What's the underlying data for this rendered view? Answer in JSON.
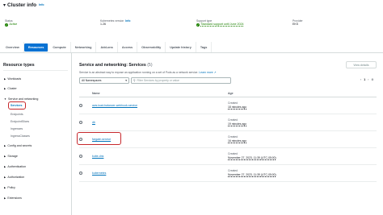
{
  "header": {
    "title": "Cluster info",
    "info_label": "Info"
  },
  "summary": {
    "status_label": "Status",
    "status_value": "Active",
    "k8s_label": "Kubernetes version",
    "k8s_info": "Info",
    "k8s_value": "1.26",
    "support_label": "Support type",
    "support_value": "Standard support until June 2024",
    "provider_label": "Provider",
    "provider_value": "EKS"
  },
  "tabs": [
    "Overview",
    "Resources",
    "Compute",
    "Networking",
    "Add-ons",
    "Access",
    "Observability",
    "Update history",
    "Tags"
  ],
  "sidebar": {
    "title": "Resource types",
    "groups": {
      "workloads": "Workloads",
      "cluster": "Cluster",
      "service_networking": "Service and networking",
      "config": "Config and secrets",
      "storage": "Storage",
      "authentication": "Authentication",
      "authorization": "Authorization",
      "policy": "Policy",
      "extensions": "Extensions"
    },
    "sub_items": [
      "Services",
      "Endpoints",
      "EndpointSlices",
      "Ingresses",
      "IngressClasses"
    ]
  },
  "main": {
    "title": "Service and networking: Services",
    "count": "(5)",
    "view_details": "View details",
    "description": "Service is an abstract way to expose an application running on a set of Pods as a network service.",
    "learn_more": "Learn more",
    "namespace_select": "All Namespaces",
    "search_placeholder": "Filter Services by property or value",
    "page_number": "1",
    "columns": {
      "name": "Name",
      "age": "Age"
    },
    "rows": [
      {
        "name": "aws-load-balancer-webhook-service",
        "age_label": "Created",
        "age": "18 minutes ago"
      },
      {
        "name": "db",
        "age_label": "Created",
        "age": "19 minutes ago"
      },
      {
        "name": "fargate-service",
        "age_label": "Created",
        "age": "16 minutes ago"
      },
      {
        "name": "kube-dns",
        "age_label": "Created",
        "age": "November 27, 2023, 11:39 (UTC-05:00)"
      },
      {
        "name": "kubernetes",
        "age_label": "Created",
        "age": "November 27, 2023, 11:39 (UTC-05:00)"
      }
    ]
  },
  "colors": {
    "accent": "#0972d3",
    "link": "#0073bb",
    "success": "#1d8102",
    "highlight": "#c7282c"
  }
}
